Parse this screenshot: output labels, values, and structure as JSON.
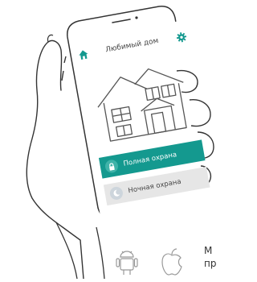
{
  "app": {
    "title": "Любимый дом",
    "home_icon": "home-icon",
    "settings_icon": "gear-icon",
    "accent_color": "#14998f"
  },
  "buttons": [
    {
      "label": "Полная охрана",
      "icon": "lock-icon",
      "active": true
    },
    {
      "label": "Ночная охрана",
      "icon": "moon-icon",
      "active": false
    }
  ],
  "caption": {
    "line1": "М",
    "line2": "пр"
  },
  "platform_icons": [
    "android-icon",
    "apple-icon"
  ]
}
